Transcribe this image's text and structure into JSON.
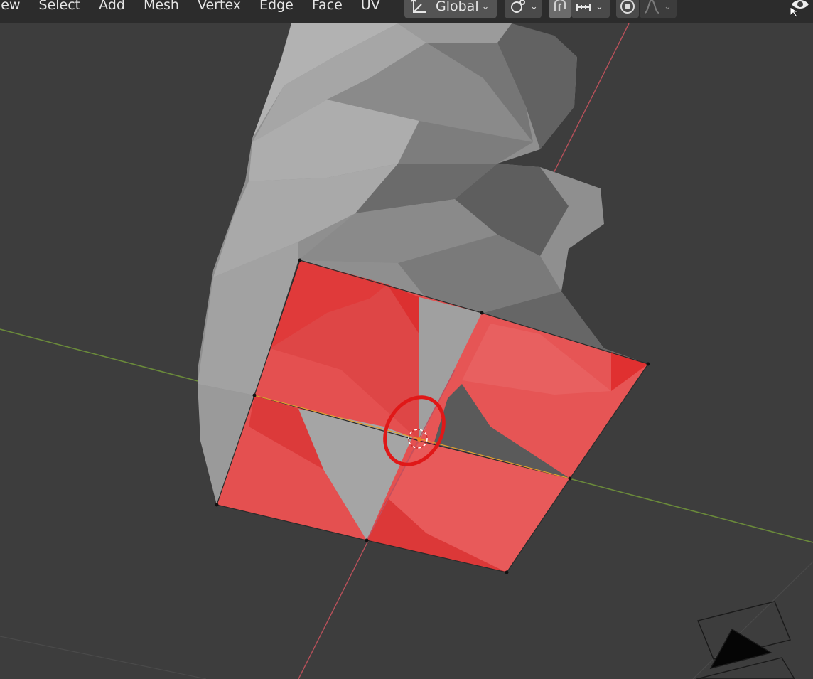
{
  "header": {
    "menu": [
      "iew",
      "Select",
      "Add",
      "Mesh",
      "Vertex",
      "Edge",
      "Face",
      "UV"
    ],
    "transform_orientation": "Global"
  },
  "icons": {
    "orientation": "transform-orientation-icon",
    "pivot": "pivot-point-icon",
    "snap": "snap-magnet-icon",
    "snap_target": "snap-increment-icon",
    "proportional": "proportional-editing-icon",
    "falloff": "falloff-curve-icon",
    "visibility": "viewport-visibility-icon"
  },
  "colors": {
    "viewport_bg": "#3d3d3d",
    "selected_face": "#e85050",
    "x_axis": "#b8505a",
    "y_axis": "#6a8a3a",
    "annotation": "#e01818"
  }
}
